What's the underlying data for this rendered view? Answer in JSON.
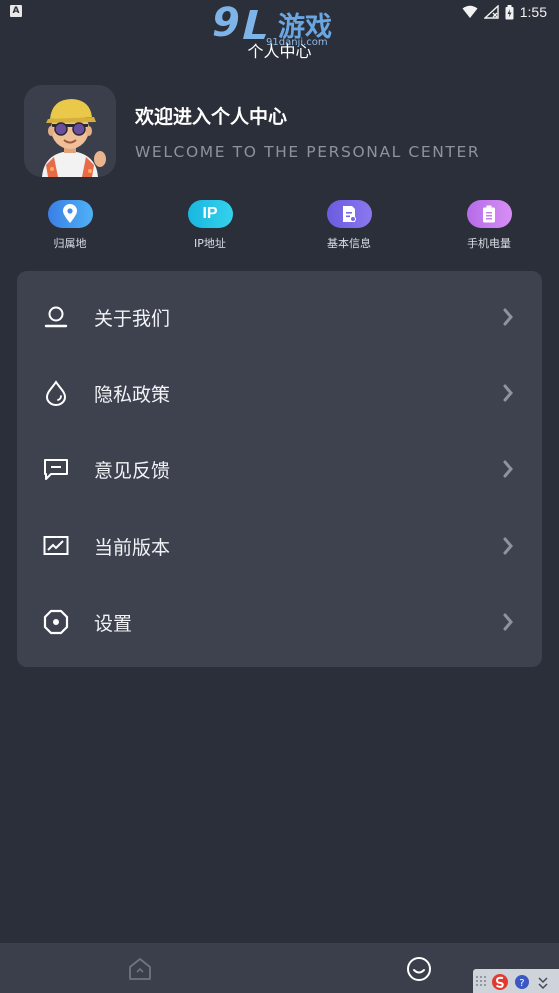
{
  "status_bar": {
    "app_icon_letter": "A",
    "time": "1:55"
  },
  "watermark": {
    "logo_number": "9",
    "logo_text": "游戏",
    "url": "91danji.com"
  },
  "page_title": "个人中心",
  "profile": {
    "welcome_title": "欢迎进入个人中心",
    "welcome_subtitle": "WELCOME TO THE PERSONAL CENTER",
    "avatar_icon": "cartoon-avatar"
  },
  "quick_actions": [
    {
      "label": "归属地",
      "icon": "location-pin-icon",
      "color": "#3e8ff0"
    },
    {
      "label": "IP地址",
      "icon": "ip-icon",
      "icon_text": "IP",
      "color": "#1ec2e4"
    },
    {
      "label": "基本信息",
      "icon": "info-card-icon",
      "color": "#7767e6"
    },
    {
      "label": "手机电量",
      "icon": "battery-icon",
      "color": "#c77cf0"
    }
  ],
  "menu": [
    {
      "label": "关于我们",
      "icon": "user-icon"
    },
    {
      "label": "隐私政策",
      "icon": "droplet-icon"
    },
    {
      "label": "意见反馈",
      "icon": "feedback-icon"
    },
    {
      "label": "当前版本",
      "icon": "trend-chart-icon"
    },
    {
      "label": "设置",
      "icon": "settings-icon"
    }
  ],
  "bottom_nav": [
    {
      "name": "home",
      "icon": "home-icon",
      "active": false
    },
    {
      "name": "mine",
      "icon": "smile-icon",
      "active": true
    }
  ],
  "colors": {
    "background": "#2b2f3a",
    "card": "#3e424f",
    "nav": "#3b3f4b"
  }
}
